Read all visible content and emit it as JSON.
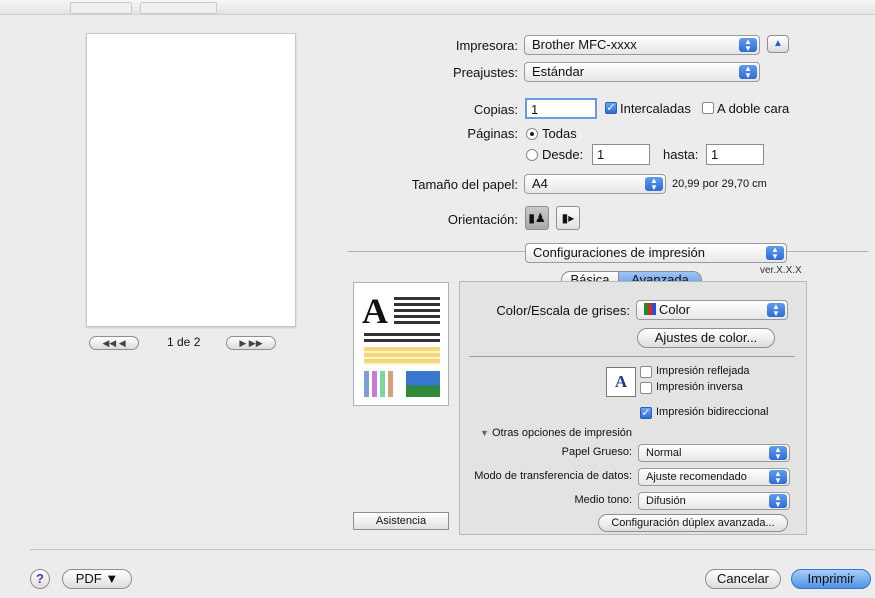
{
  "printer": {
    "label": "Impresora:",
    "value": "Brother MFC-xxxx"
  },
  "presets": {
    "label": "Preajustes:",
    "value": "Estándar"
  },
  "copies": {
    "label": "Copias:",
    "value": "1",
    "collated_label": "Intercaladas",
    "collated": true,
    "duplex_label": "A doble cara",
    "duplex": false
  },
  "pages": {
    "label": "Páginas:",
    "all_label": "Todas",
    "from_label": "Desde:",
    "from_value": "1",
    "to_label": "hasta:",
    "to_value": "1",
    "selected": "all"
  },
  "paper_size": {
    "label": "Tamaño del papel:",
    "value": "A4",
    "dimensions": "20,99 por 29,70 cm"
  },
  "orientation": {
    "label": "Orientación:",
    "selected": "portrait"
  },
  "section_popup": {
    "value": "Configuraciones de impresión"
  },
  "version": "ver.X.X.X",
  "tabs": [
    {
      "label": "Básica",
      "selected": false
    },
    {
      "label": "Avanzada",
      "selected": true
    }
  ],
  "color": {
    "label": "Color/Escala de grises:",
    "value": "Color",
    "button_label": "Ajustes de color..."
  },
  "mirror": {
    "label": "Impresión reflejada",
    "checked": false
  },
  "reverse": {
    "label": "Impresión inversa",
    "checked": false
  },
  "bidirectional": {
    "label": "Impresión bidireccional",
    "checked": true
  },
  "other_options": {
    "disclosure_label": "Otras opciones de impresión",
    "thick_paper": {
      "label": "Papel Grueso:",
      "value": "Normal"
    },
    "transfer_mode": {
      "label": "Modo de transferencia de datos:",
      "value": "Ajuste recomendado"
    },
    "halftone": {
      "label": "Medio tono:",
      "value": "Difusión"
    },
    "duplex_button_label": "Configuración dúplex avanzada..."
  },
  "preview_nav": {
    "page_text": "1 de 2"
  },
  "assist_label": "Asistencia",
  "help_label": "?",
  "pdf_label": "PDF ▼",
  "cancel_label": "Cancelar",
  "print_label": "Imprimir",
  "icons": {
    "popup_arrows": "up-down-arrows-icon",
    "collapse": "triangle-up-icon",
    "disclosure": "triangle-down-icon"
  }
}
